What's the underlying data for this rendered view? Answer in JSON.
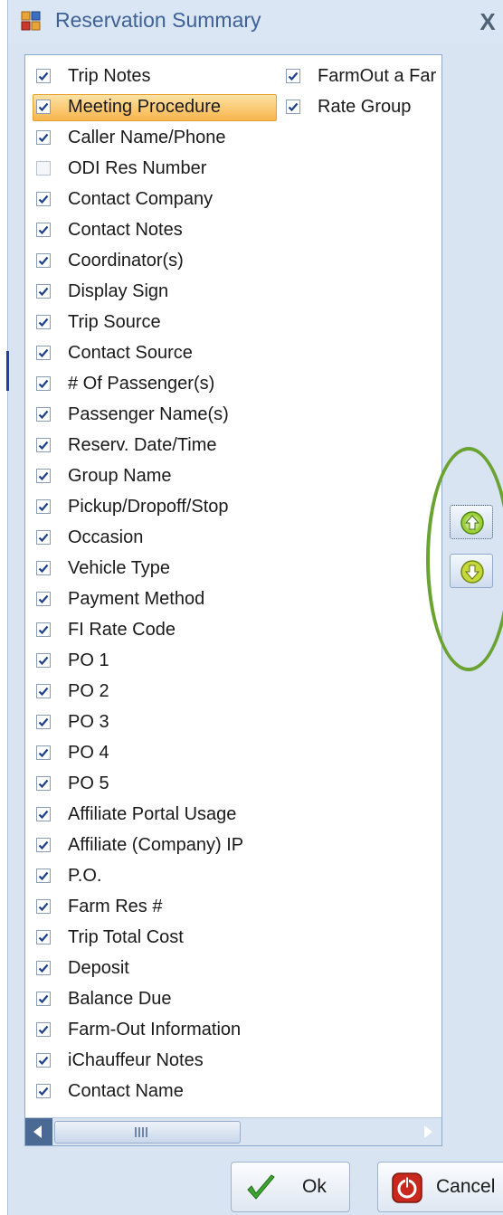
{
  "window": {
    "title": "Reservation Summary",
    "close_symbol": "X"
  },
  "list": {
    "column1": [
      {
        "label": "Trip Notes",
        "checked": true
      },
      {
        "label": "Meeting Procedure",
        "checked": true,
        "selected": true
      },
      {
        "label": "Caller Name/Phone",
        "checked": true
      },
      {
        "label": "ODI Res Number",
        "checked": false
      },
      {
        "label": "Contact Company",
        "checked": true
      },
      {
        "label": "Contact Notes",
        "checked": true
      },
      {
        "label": "Coordinator(s)",
        "checked": true
      },
      {
        "label": "Display Sign",
        "checked": true
      },
      {
        "label": "Trip Source",
        "checked": true
      },
      {
        "label": "Contact Source",
        "checked": true
      },
      {
        "label": "# Of Passenger(s)",
        "checked": true
      },
      {
        "label": "Passenger Name(s)",
        "checked": true
      },
      {
        "label": "Reserv. Date/Time",
        "checked": true
      },
      {
        "label": "Group Name",
        "checked": true
      },
      {
        "label": "Pickup/Dropoff/Stop",
        "checked": true
      },
      {
        "label": "Occasion",
        "checked": true
      },
      {
        "label": "Vehicle Type",
        "checked": true
      },
      {
        "label": "Payment Method",
        "checked": true
      },
      {
        "label": "FI Rate Code",
        "checked": true
      },
      {
        "label": "PO 1",
        "checked": true
      },
      {
        "label": "PO 2",
        "checked": true
      },
      {
        "label": "PO 3",
        "checked": true
      },
      {
        "label": "PO 4",
        "checked": true
      },
      {
        "label": "PO 5",
        "checked": true
      },
      {
        "label": "Affiliate Portal Usage",
        "checked": true
      },
      {
        "label": "Affiliate (Company) IP",
        "checked": true
      },
      {
        "label": "P.O.",
        "checked": true
      },
      {
        "label": "Farm Res #",
        "checked": true
      },
      {
        "label": "Trip Total Cost",
        "checked": true
      },
      {
        "label": "Deposit",
        "checked": true
      },
      {
        "label": "Balance Due",
        "checked": true
      },
      {
        "label": "Farm-Out Information",
        "checked": true
      },
      {
        "label": "iChauffeur Notes",
        "checked": true
      },
      {
        "label": "Contact Name",
        "checked": true
      }
    ],
    "column2": [
      {
        "label": "FarmOut a Far",
        "checked": true
      },
      {
        "label": "Rate Group",
        "checked": true
      }
    ]
  },
  "buttons": {
    "ok_label": "Ok",
    "cancel_label": "Cancel"
  },
  "icons": {
    "app": "reservation-window-icon",
    "move_up": "move-up-arrow-icon",
    "move_down": "move-down-arrow-icon",
    "ok": "green-checkmark-icon",
    "cancel": "red-power-icon"
  },
  "colors": {
    "selection": "#f8b54c",
    "highlight_ellipse": "#6aa331",
    "checkmark": "#1c3f8c"
  }
}
